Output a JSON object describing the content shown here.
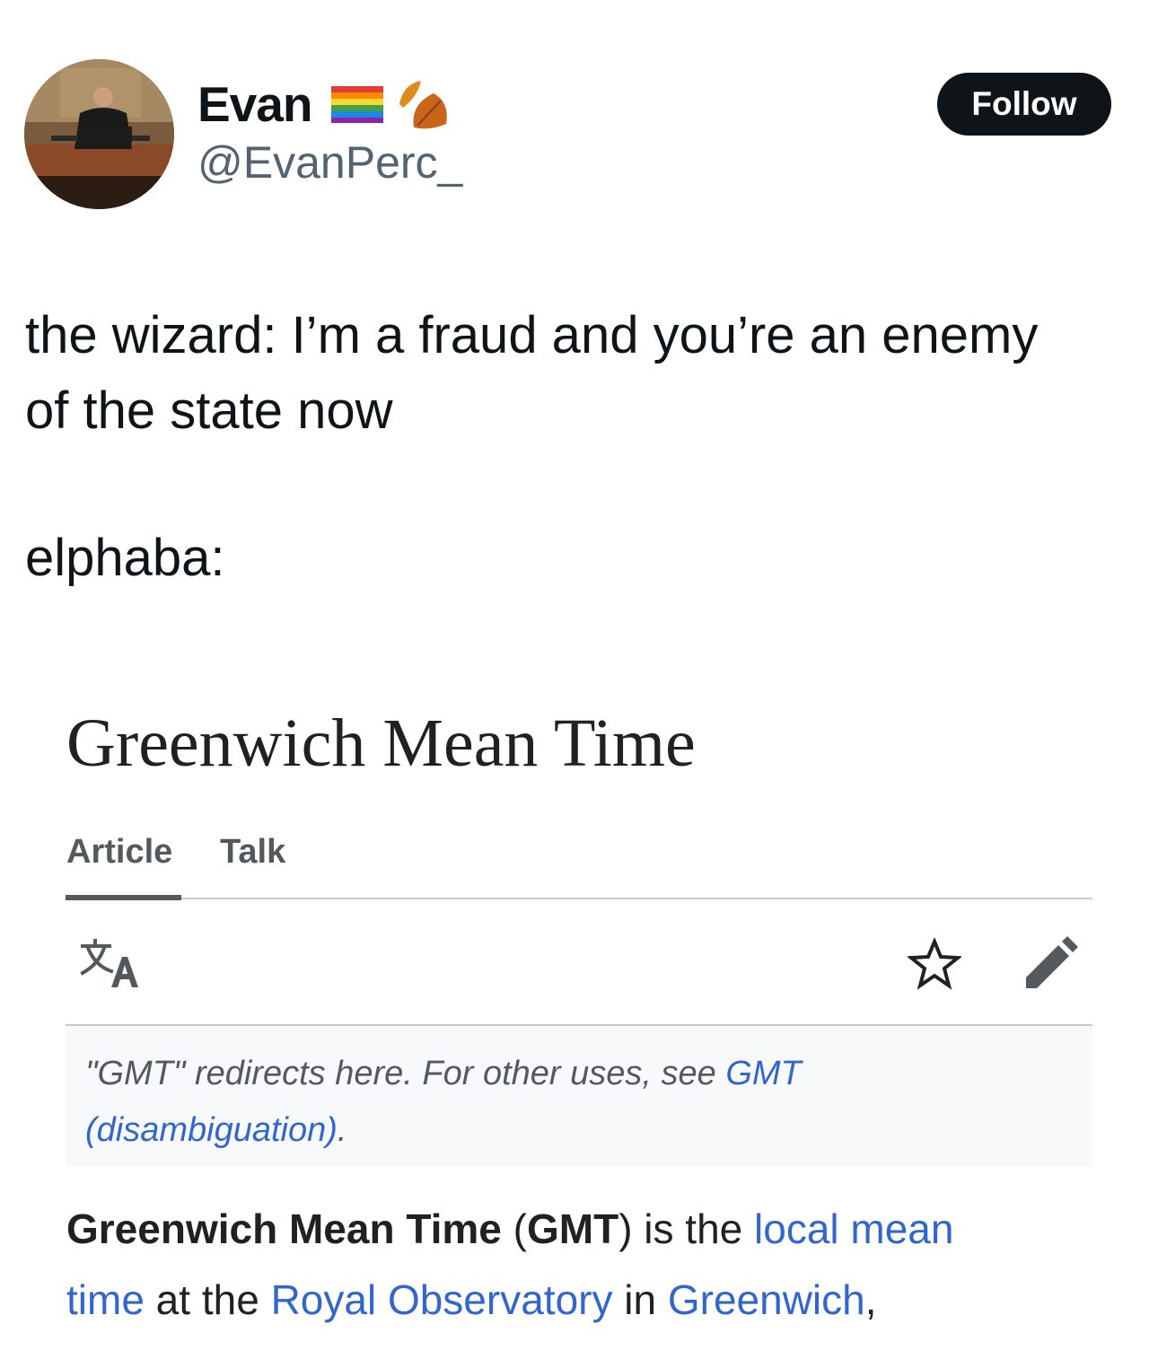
{
  "tweet": {
    "display_name": "Evan",
    "name_emojis": [
      "rainbow-flag",
      "fallen-leaves"
    ],
    "handle": "@EvanPerc_",
    "follow_label": "Follow",
    "text_line1": "the wizard: I’m a fraud and you’re an enemy",
    "text_line2": "of the state now",
    "text_line3": "elphaba:"
  },
  "wiki": {
    "title": "Greenwich Mean Time",
    "tabs": [
      {
        "label": "Article",
        "active": true
      },
      {
        "label": "Talk",
        "active": false
      }
    ],
    "toolbar_icons": [
      "language-icon",
      "star-icon",
      "edit-pencil-icon"
    ],
    "hatnote": {
      "prefix": "\"GMT\" redirects here. For other uses, see ",
      "link_part1": "GMT",
      "link_part2": "(disambiguation)",
      "suffix": "."
    },
    "lead": {
      "bold1": "Greenwich Mean Time",
      "t1": " (",
      "bold2": "GMT",
      "t2": ") is the ",
      "link1_a": "local mean",
      "link1_b": "time",
      "t3": " at the ",
      "link2": "Royal Observatory",
      "t4": " in ",
      "link3": "Greenwich",
      "t5": ","
    }
  },
  "colors": {
    "text_primary": "#0f1419",
    "text_secondary": "#536471",
    "follow_bg": "#0f1419",
    "wiki_link": "#3366cc",
    "wiki_text": "#202122",
    "wiki_muted": "#54595d",
    "hatnote_bg": "#f8f9fa"
  }
}
